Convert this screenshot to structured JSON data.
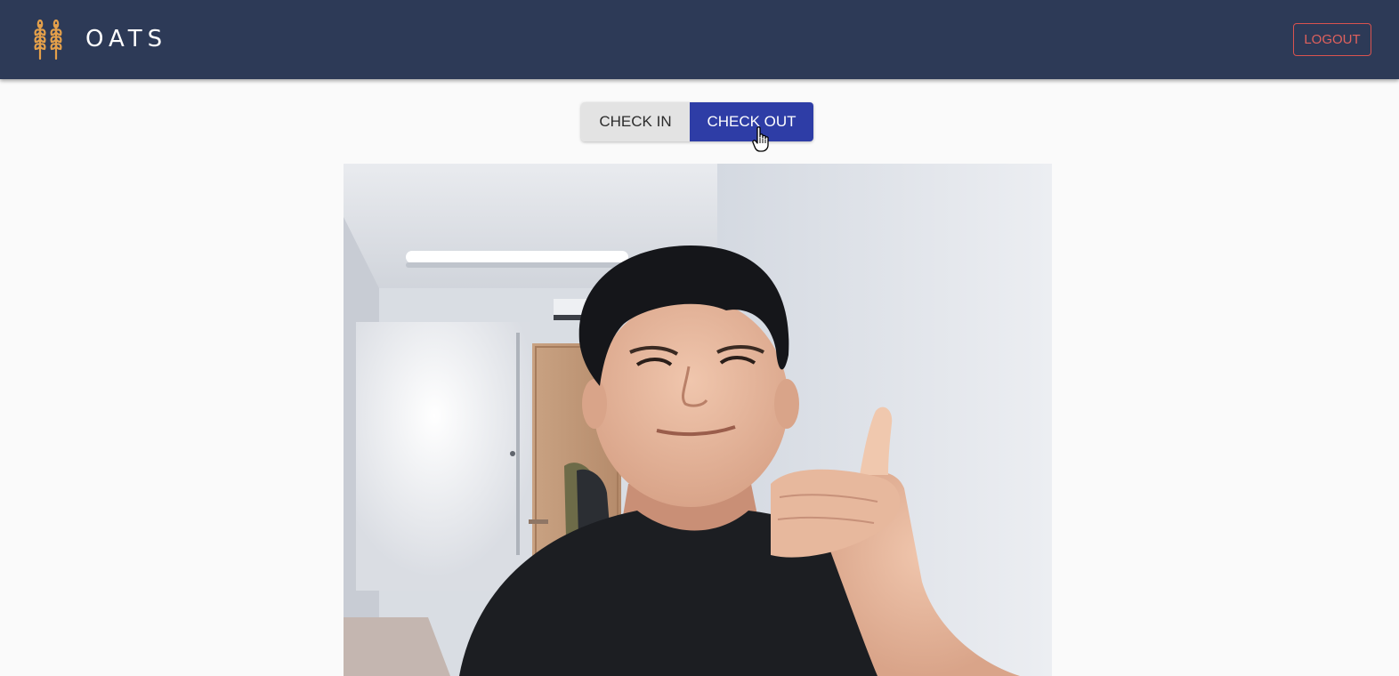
{
  "header": {
    "app_name": "OATS",
    "logo_icon": "wheat-icon",
    "logout_label": "LOGOUT",
    "background": "#2d3a57",
    "logout_color": "#d9534f"
  },
  "attendance_toggle": {
    "options": [
      {
        "label": "CHECK IN",
        "selected": false
      },
      {
        "label": "CHECK OUT",
        "selected": true
      }
    ],
    "selected_color": "#2e3da6",
    "unselected_color": "#e3e3e3"
  },
  "camera": {
    "content": "webcam-preview"
  }
}
